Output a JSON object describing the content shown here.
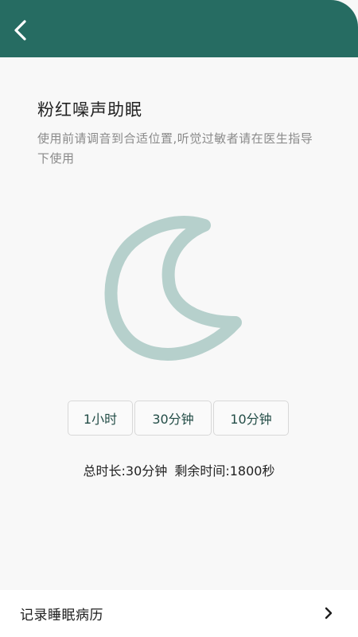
{
  "header": {
    "back_icon": "chevron-left-icon",
    "background_color": "#266c62"
  },
  "main": {
    "title": "粉红噪声助眠",
    "description": "使用前请调音到合适位置,听觉过敏者请在医生指导下使用",
    "moon_icon": "moon-icon",
    "moon_color": "#b6d0cc",
    "timer_options": [
      "1小时",
      "30分钟",
      "10分钟"
    ],
    "status": {
      "total": "总时长:30分钟",
      "remaining": "剩余时间:1800秒"
    }
  },
  "footer": {
    "record_label": "记录睡眠病历",
    "arrow_icon": "chevron-right-icon"
  }
}
